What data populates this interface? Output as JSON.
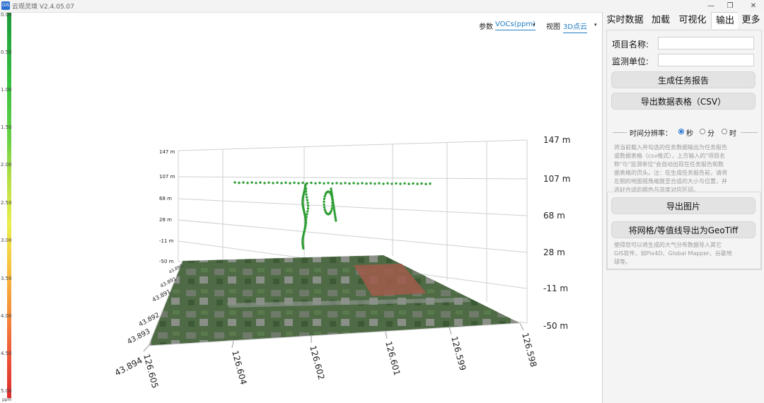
{
  "app": {
    "title": "云观灵境 V2.4.05.07",
    "icon_text": "GIS"
  },
  "window_controls": {
    "minimize": "—",
    "restore": "❐",
    "close": "✕"
  },
  "colorbar": {
    "labels": [
      "0.00",
      "0.50",
      "1.00",
      "1.50",
      "2.00",
      "2.50",
      "3.00",
      "3.50",
      "4.00",
      "4.50",
      "5.00"
    ],
    "unit": "ppm"
  },
  "plot_controls": {
    "param_label": "参数",
    "param_value": "VOCs(ppm)",
    "view_label": "视图",
    "view_value": "3D点云",
    "arrow": "▾"
  },
  "tabs": [
    "实时数据",
    "加载",
    "可视化",
    "输出",
    "更多"
  ],
  "active_tab": "输出",
  "form": {
    "project_label": "项目名称:",
    "project_value": "",
    "unit_label": "监测单位:",
    "unit_value": ""
  },
  "buttons": {
    "report": "生成任务报告",
    "export_csv": "导出数据表格（CSV）",
    "export_image": "导出图片",
    "export_geotiff": "将网格/等值线导出为GeoTiff"
  },
  "time_resolution": {
    "label": "时间分辨率：",
    "options": [
      "秒",
      "分",
      "时"
    ],
    "selected": "秒"
  },
  "help_texts": {
    "report": [
      "将当前载入并勾选的任务数据输出为任务报告",
      "或数据表格（csv格式），上方输入的\"项目名",
      "称\"与\"监测单位\"会自动出现在任务报告和数",
      "据表格的页头。注：在生成任务报告前，请将",
      "左侧的地图视角缩放至合适的大小与位置，并",
      "选好合适的颜色与浓度对应区间。"
    ],
    "geotiff": [
      "使得您可以将生成的大气分布数据导入其它",
      "GIS软件，如Pix4D、Global Mapper、谷歌地",
      "球等。"
    ]
  },
  "chart_data": {
    "type": "scatter",
    "title": "",
    "series_color": "#2e9e34",
    "z_axis": {
      "unit": "m",
      "range": [
        -50,
        147
      ],
      "ticks_left": [
        "147 m",
        "107 m",
        "68 m",
        "28 m",
        "-11 m",
        "-50 m"
      ],
      "ticks_right": [
        "147 m",
        "107 m",
        "68 m",
        "28 m",
        "-11 m",
        "-50 m"
      ]
    },
    "lat_axis": {
      "ticks": [
        "43.890",
        "43.891",
        "43.892",
        "43.893",
        "43.894"
      ]
    },
    "lon_axis": {
      "ticks": [
        "126.605",
        "126.604",
        "126.602",
        "126.601",
        "126.599",
        "126.598"
      ]
    },
    "legend": "none",
    "grid": true
  }
}
